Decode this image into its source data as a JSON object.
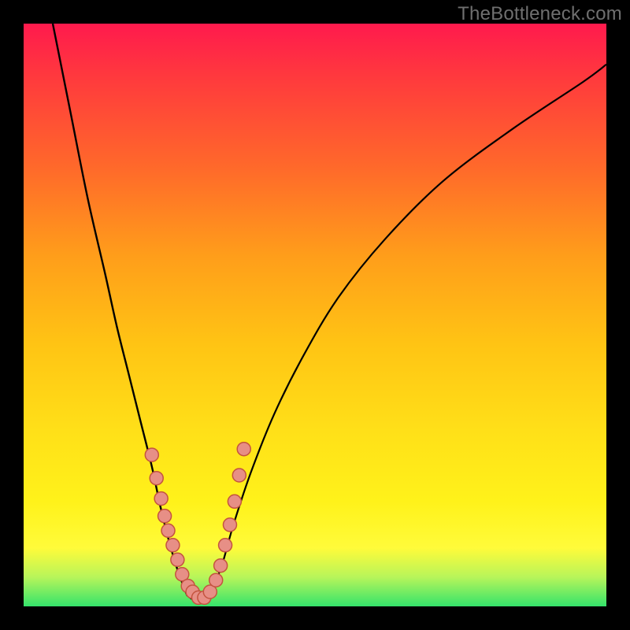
{
  "watermark": "TheBottleneck.com",
  "colors": {
    "frame": "#000000",
    "curve": "#000000",
    "dot_fill": "#e78f86",
    "dot_stroke": "#c4543f",
    "gradient_stops": [
      "#ff1a4d",
      "#ff3c3c",
      "#ff6a2a",
      "#ff9e1a",
      "#ffc414",
      "#ffe018",
      "#fff21a",
      "#fffb3a",
      "#b7f55a",
      "#34e36b"
    ]
  },
  "chart_data": {
    "type": "line",
    "title": "",
    "xlabel": "",
    "ylabel": "",
    "xlim": [
      0,
      100
    ],
    "ylim": [
      0,
      100
    ],
    "series": [
      {
        "name": "left-branch",
        "x": [
          5,
          8,
          11,
          14,
          16,
          18,
          20,
          22,
          23.5,
          25,
          26.5,
          28
        ],
        "y": [
          100,
          85,
          70,
          57,
          48,
          40,
          32,
          24,
          17,
          11,
          6,
          2
        ]
      },
      {
        "name": "right-branch",
        "x": [
          32,
          34,
          36,
          39,
          43,
          48,
          54,
          62,
          72,
          84,
          96,
          100
        ],
        "y": [
          2,
          7,
          14,
          23,
          33,
          43,
          53,
          63,
          73,
          82,
          90,
          93
        ]
      },
      {
        "name": "valley-floor",
        "x": [
          28,
          29.5,
          31,
          32
        ],
        "y": [
          2,
          1,
          1,
          2
        ]
      }
    ],
    "markers": {
      "name": "highlight-dots",
      "x": [
        22.0,
        22.8,
        23.6,
        24.2,
        24.8,
        25.6,
        26.4,
        27.2,
        28.2,
        29.0,
        30.0,
        31.0,
        32.0,
        33.0,
        33.8,
        34.6,
        35.4,
        36.2,
        37.0,
        37.8
      ],
      "y": [
        26.0,
        22.0,
        18.5,
        15.5,
        13.0,
        10.5,
        8.0,
        5.5,
        3.5,
        2.5,
        1.5,
        1.5,
        2.5,
        4.5,
        7.0,
        10.5,
        14.0,
        18.0,
        22.5,
        27.0
      ]
    }
  }
}
